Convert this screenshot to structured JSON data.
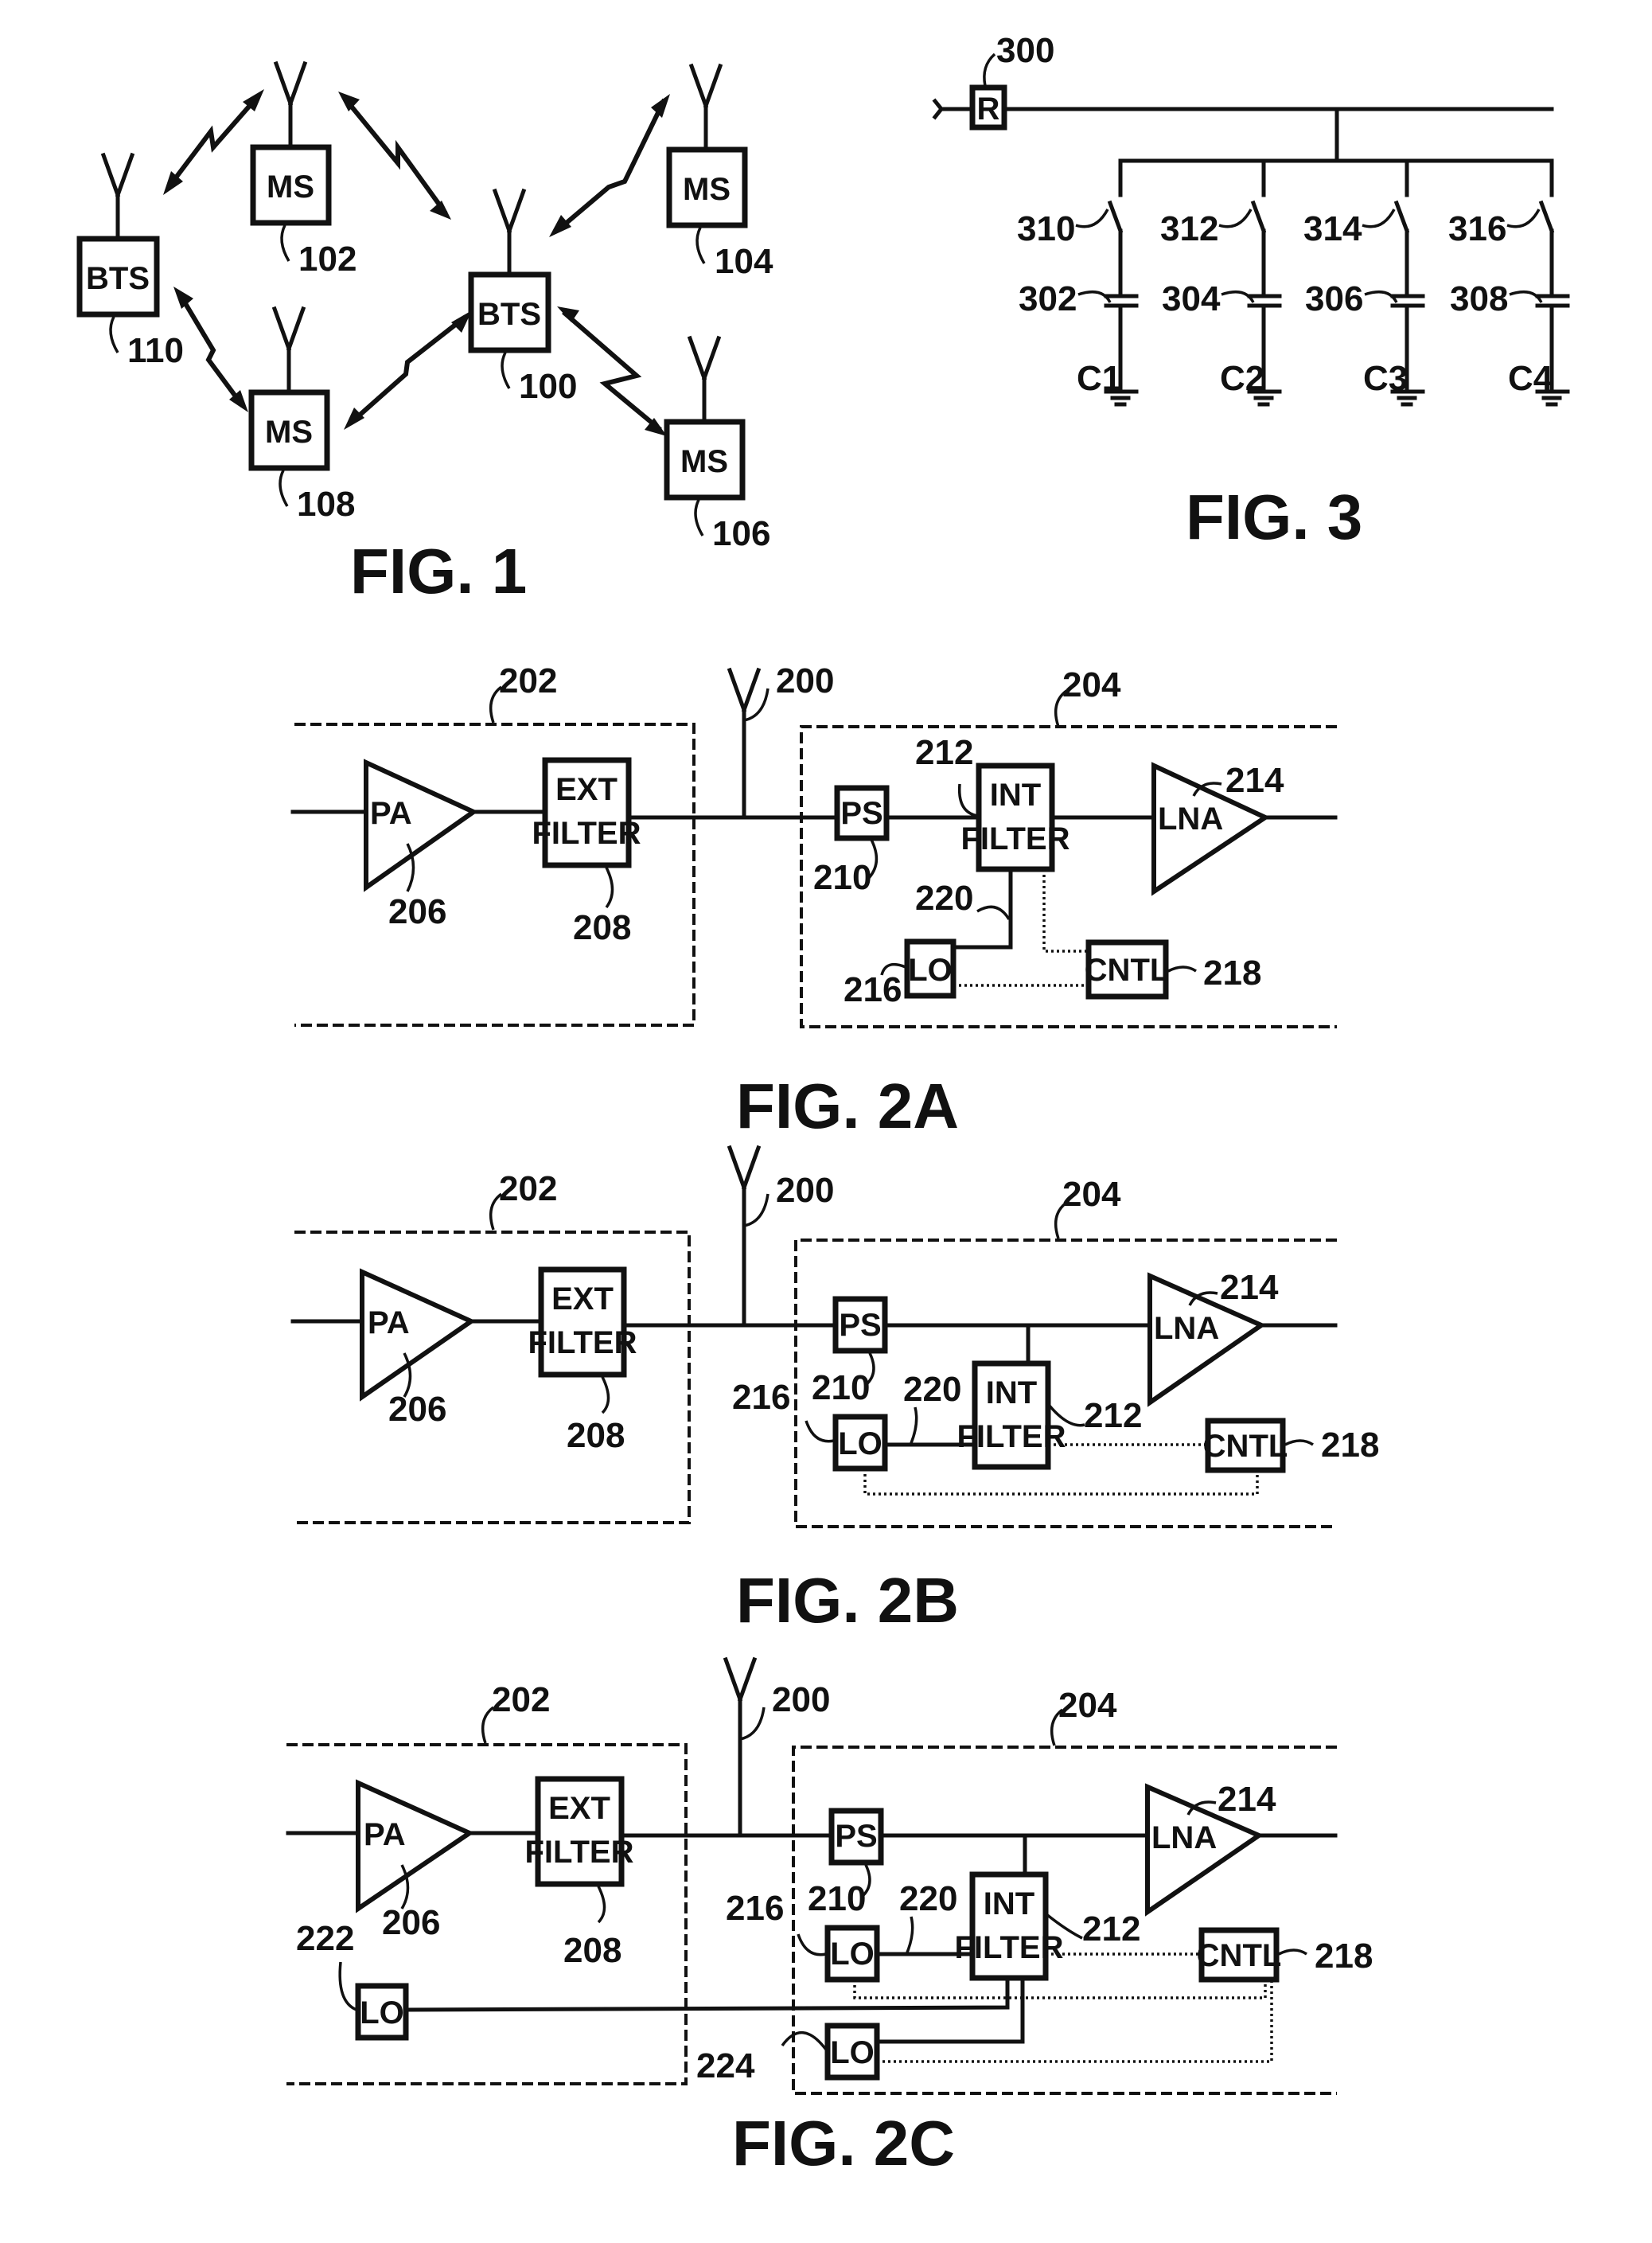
{
  "fig1": {
    "caption": "FIG. 1",
    "stations": [
      {
        "label": "MS",
        "ref": "102"
      },
      {
        "label": "MS",
        "ref": "104"
      },
      {
        "label": "MS",
        "ref": "106"
      },
      {
        "label": "MS",
        "ref": "108"
      },
      {
        "label": "BTS",
        "ref": "100"
      },
      {
        "label": "BTS",
        "ref": "110"
      }
    ]
  },
  "fig3": {
    "caption": "FIG. 3",
    "resistor": {
      "label": "R",
      "ref": "300"
    },
    "switches": [
      "310",
      "312",
      "314",
      "316"
    ],
    "capacitor_refs": [
      "302",
      "304",
      "306",
      "308"
    ],
    "capacitor_labels": [
      "C1",
      "C2",
      "C3",
      "C4"
    ]
  },
  "fig2": {
    "common": {
      "antenna_ref": "200",
      "tx_ref": "202",
      "rx_ref": "204",
      "pa_label": "PA",
      "pa_ref": "206",
      "ext_filter_line1": "EXT",
      "ext_filter_line2": "FILTER",
      "ext_filter_ref": "208",
      "ps_label": "PS",
      "ps_ref": "210",
      "int_filter_line1": "INT",
      "int_filter_line2": "FILTER",
      "int_filter_ref": "212",
      "lna_label": "LNA",
      "lna_ref": "214",
      "lo_label": "LO",
      "lo_ref": "216",
      "cntl_label": "CNTL",
      "cntl_ref": "218",
      "path_ref": "220"
    },
    "captions": [
      "FIG. 2A",
      "FIG. 2B",
      "FIG. 2C"
    ],
    "fig2c_extra": {
      "tx_lo_label": "LO",
      "tx_lo_ref": "222",
      "rx_lo2_label": "LO",
      "rx_lo2_ref": "224"
    }
  }
}
